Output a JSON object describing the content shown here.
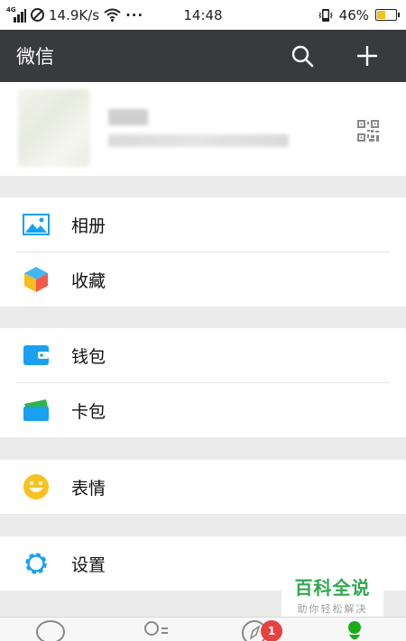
{
  "status_bar": {
    "network_label": "4G",
    "speed": "14.9K/s",
    "more": "···",
    "time": "14:48",
    "battery": "46%",
    "battery_level_percent": 46
  },
  "app_bar": {
    "title": "微信"
  },
  "menu_groups": [
    {
      "items": [
        {
          "label": "相册",
          "icon": "photo-album-icon"
        },
        {
          "label": "收藏",
          "icon": "favorites-cube-icon"
        }
      ]
    },
    {
      "items": [
        {
          "label": "钱包",
          "icon": "wallet-icon"
        },
        {
          "label": "卡包",
          "icon": "card-pack-icon"
        }
      ]
    },
    {
      "items": [
        {
          "label": "表情",
          "icon": "sticker-smiley-icon"
        }
      ]
    },
    {
      "items": [
        {
          "label": "设置",
          "icon": "settings-gear-icon"
        }
      ]
    }
  ],
  "watermark": {
    "title": "百科全说",
    "subtitle": "助你轻松解决"
  },
  "bottom_nav": {
    "discover_badge": "1",
    "tabs": [
      "chat-icon",
      "contacts-icon",
      "discover-compass-icon",
      "me-person-icon"
    ]
  },
  "colors": {
    "app_bar": "#393a3e",
    "background": "#ebebeb",
    "accent_blue": "#1aa0f0",
    "badge_red": "#e64340",
    "wechat_green": "#1aad19",
    "sticker_yellow": "#f8c21e"
  }
}
